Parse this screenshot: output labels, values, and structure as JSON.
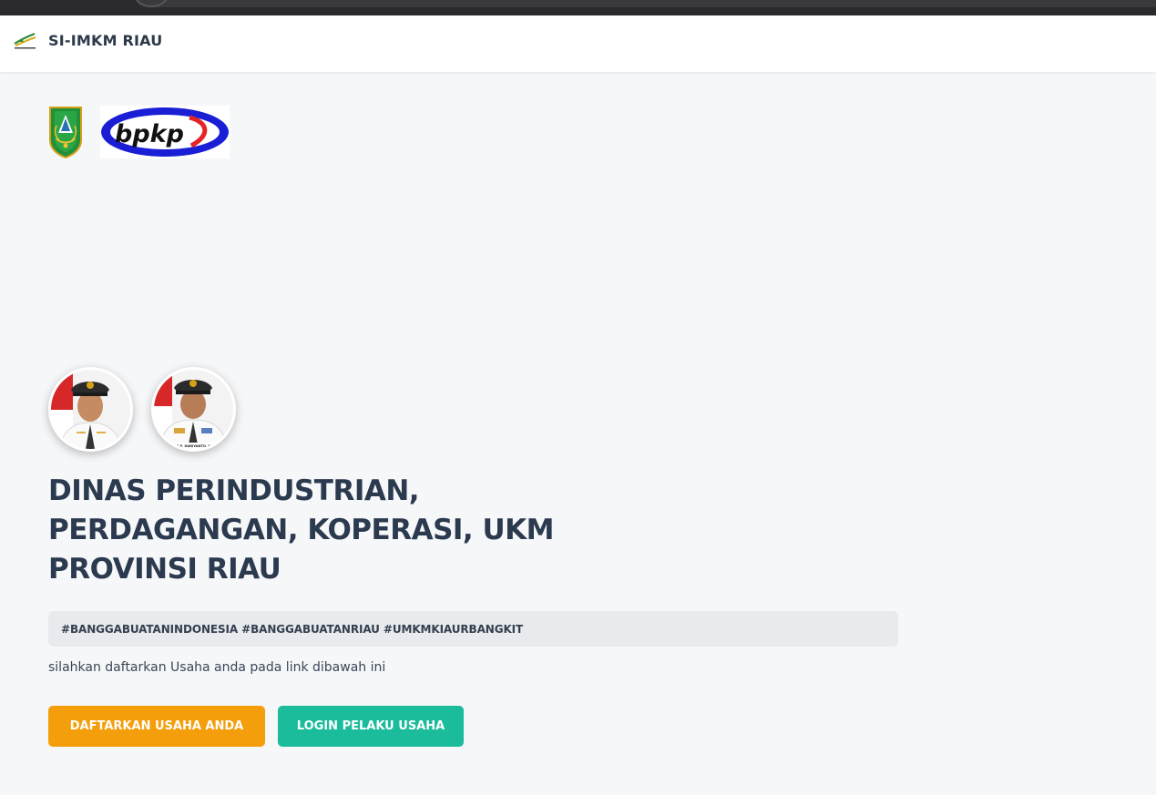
{
  "navbar": {
    "brand_name": "SI-IMKM RIAU",
    "brand_logo_icon": "si-imkm-riau-logo"
  },
  "logos": {
    "riau_emblem_icon": "riau-province-emblem",
    "bpkp_logo_text": "bpkp"
  },
  "officials": [
    {
      "photo": "governor-portrait",
      "caption": ""
    },
    {
      "photo": "vice-governor-portrait",
      "caption": "H. S.F. HARIYANTO, M.T."
    }
  ],
  "headline": {
    "line1": "DINAS PERINDUSTRIAN,",
    "line2": "PERDAGANGAN, KOPERASI, UKM",
    "line3": "PROVINSI RIAU"
  },
  "hashtags": "#BANGGABUATANINDONESIA #BANGGABUATANRIAU #UMKMKIAURBANGKIT",
  "subtext": "silahkan daftarkan Usaha anda pada link dibawah ini",
  "buttons": {
    "register_label": "DAFTARKAN USAHA ANDA",
    "login_label": "LOGIN PELAKU USAHA"
  },
  "colors": {
    "accent_orange": "#f59e0b",
    "accent_teal": "#1abc9c",
    "heading": "#2b3a4f",
    "page_bg": "#f6f7f9"
  }
}
